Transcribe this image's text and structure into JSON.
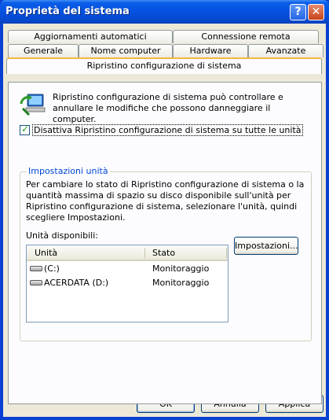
{
  "window": {
    "title": "Proprietà del sistema",
    "help_label": "?",
    "close_label": "✕"
  },
  "tabs": {
    "row1": [
      "Aggiornamenti automatici",
      "Connessione remota"
    ],
    "row2": [
      "Generale",
      "Nome computer",
      "Hardware",
      "Avanzate"
    ],
    "active": "Ripristino configurazione di sistema"
  },
  "panel": {
    "description": "Ripristino configurazione di sistema può controllare e annullare le modifiche che possono danneggiare il computer.",
    "disable_checkbox_label": "Disattiva Ripristino configurazione di sistema su tutte le unità",
    "disable_checked": true,
    "group_title": "Impostazioni unità",
    "group_text": "Per cambiare lo stato di Ripristino configurazione di sistema o la quantità massima di spazio su disco disponibile sull'unità per Ripristino configurazione di sistema, selezionare l'unità, quindi scegliere Impostazioni.",
    "list_label": "Unità disponibili:",
    "columns": [
      "Unità",
      "Stato"
    ],
    "drives": [
      {
        "name": "(C:)",
        "status": "Monitoraggio"
      },
      {
        "name": "ACERDATA (D:)",
        "status": "Monitoraggio"
      }
    ],
    "settings_button": "Impostazioni..."
  },
  "buttons": {
    "ok": "OK",
    "cancel": "Annulla",
    "apply": "Applica"
  }
}
